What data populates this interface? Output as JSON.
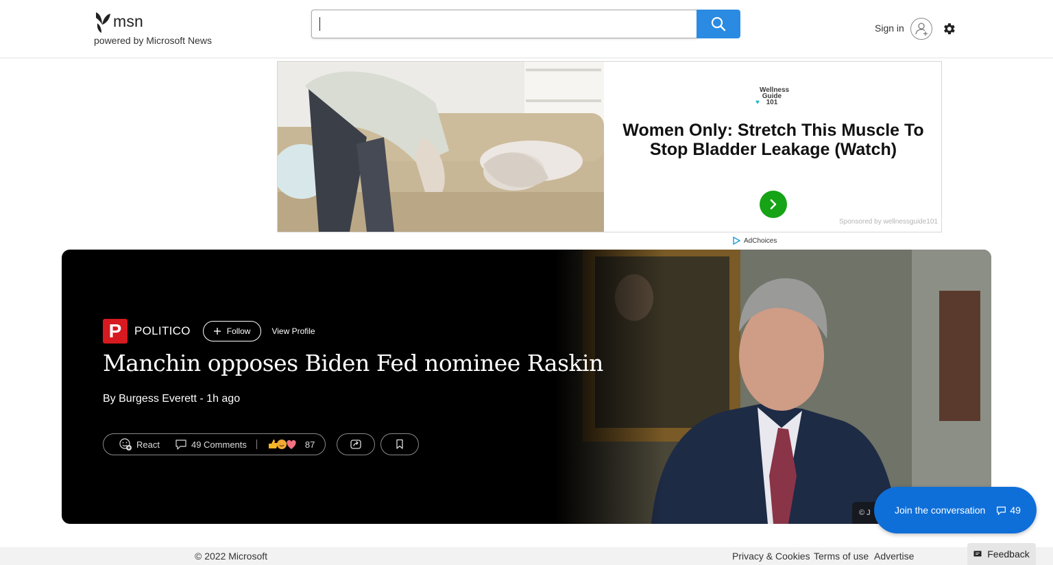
{
  "header": {
    "logo_text": "msn",
    "powered_by": "powered by Microsoft News",
    "search_value": "",
    "signin_label": "Sign in"
  },
  "ad": {
    "brand": "Wellness Guide 101",
    "headline": "Women Only: Stretch This Muscle To Stop Bladder Leakage (Watch)",
    "sponsor": "Sponsored by wellnessguide101",
    "adchoices": "AdChoices"
  },
  "article": {
    "provider": "POLITICO",
    "provider_initial": "P",
    "follow_label": "Follow",
    "view_profile_label": "View Profile",
    "headline": "Manchin opposes Biden Fed nominee Raskin",
    "byline": "By Burgess Everett - 1h ago",
    "react_label": "React",
    "comments_label": "49 Comments",
    "reactions_count": "87",
    "photo_credit": "© J"
  },
  "conversation": {
    "label": "Join the conversation",
    "count": "49"
  },
  "footer": {
    "copyright": "© 2022 Microsoft",
    "links": [
      "Privacy & Cookies",
      "Terms of use",
      "Advertise"
    ],
    "feedback_label": "Feedback"
  },
  "colors": {
    "search_button": "#2b8ae2",
    "politico_red": "#d71920",
    "join_blue": "#0f6fd8",
    "ad_arrow_green": "#16a316"
  }
}
